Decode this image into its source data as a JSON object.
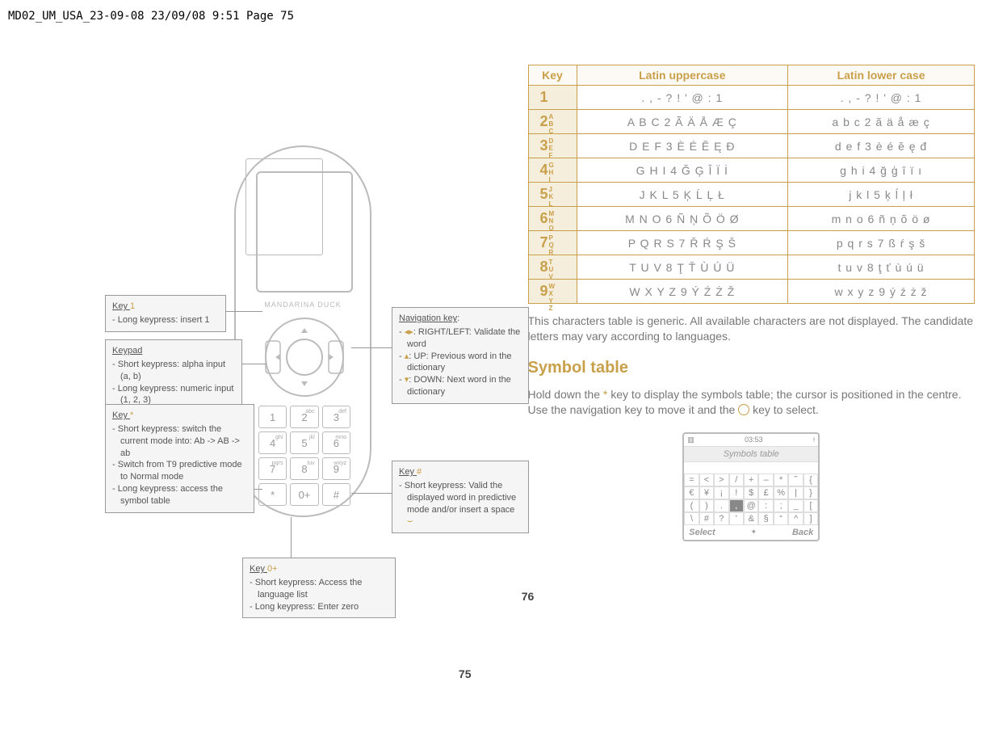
{
  "header": "MD02_UM_USA_23-09-08  23/09/08  9:51  Page 75",
  "left_page_num": "75",
  "right_page_num": "76",
  "phone_brand": "MANDARINA DUCK",
  "callouts": {
    "key1": {
      "title_prefix": "Key ",
      "key_glyph": "1",
      "items": [
        "Long keypress: insert 1"
      ]
    },
    "keypad": {
      "title": "Keypad",
      "items": [
        "Short keypress: alpha input (a, b)",
        "Long keypress: numeric input (1, 2, 3)"
      ]
    },
    "keystar": {
      "title_prefix": "Key ",
      "key_glyph": "*",
      "items": [
        "Short keypress: switch the current mode into: Ab -> AB -> ab",
        "Switch from T9 predictive mode to Normal mode",
        "Long keypress: access the symbol table"
      ]
    },
    "key0": {
      "title_prefix": "Key ",
      "key_glyph": "0+",
      "items": [
        "Short keypress: Access the language list",
        "Long keypress: Enter zero"
      ]
    },
    "nav": {
      "title": "Navigation key",
      "items_raw": [
        {
          "icon": "lr-icon",
          "text": ": RIGHT/LEFT: Validate the word"
        },
        {
          "icon": "up-icon",
          "text": ": UP: Previous word in the dictionary"
        },
        {
          "icon": "down-icon",
          "text": ": DOWN: Next word in the dictionary"
        }
      ],
      "i1": ": RIGHT/LEFT: Validate the word",
      "i2": ": UP: Previous word in the dictionary",
      "i3": ": DOWN: Next word in the dictionary"
    },
    "keyhash": {
      "title_prefix": "Key ",
      "key_glyph": "#",
      "items": [
        "Short keypress: Valid the displayed word in predictive mode and/or insert a space"
      ]
    }
  },
  "keypad_keys": [
    {
      "main": "1",
      "sub": ""
    },
    {
      "main": "2",
      "sub": "abc"
    },
    {
      "main": "3",
      "sub": "def"
    },
    {
      "main": "4",
      "sub": "ghi"
    },
    {
      "main": "5",
      "sub": "jkl"
    },
    {
      "main": "6",
      "sub": "mno"
    },
    {
      "main": "7",
      "sub": "pqrs"
    },
    {
      "main": "8",
      "sub": "tuv"
    },
    {
      "main": "9",
      "sub": "wxyz"
    },
    {
      "main": "*",
      "sub": ""
    },
    {
      "main": "0+",
      "sub": ""
    },
    {
      "main": "#",
      "sub": ""
    }
  ],
  "char_table": {
    "headers": {
      "key": "Key",
      "upper": "Latin uppercase",
      "lower": "Latin lower case"
    },
    "rows": [
      {
        "key": "1",
        "sub": "",
        "upper": ". , - ? ! ' @ : 1",
        "lower": ". , - ? ! ' @ : 1"
      },
      {
        "key": "2",
        "sub": "ABC",
        "upper": "A B C 2 Ã Ä Å Æ Ç",
        "lower": "a b c 2 ã ä å æ ç"
      },
      {
        "key": "3",
        "sub": "DEF",
        "upper": "D E F 3 È É Ĕ Ę Đ",
        "lower": "d e f 3 è é ĕ ę đ"
      },
      {
        "key": "4",
        "sub": "GHI",
        "upper": "G H I 4 Ğ Ģ Î Ï İ",
        "lower": "g h i 4 ğ ģ î ï ı"
      },
      {
        "key": "5",
        "sub": "JKL",
        "upper": "J K L 5 Ķ Ĺ Ļ Ł",
        "lower": "j k l 5 ķ ĺ ļ ł"
      },
      {
        "key": "6",
        "sub": "MNO",
        "upper": "M N O 6 Ñ Ņ Õ Ö Ø",
        "lower": "m n o 6 ñ ņ õ ö ø"
      },
      {
        "key": "7",
        "sub": "PQRS",
        "upper": "P Q R S 7 Ř Ŕ Ş Š",
        "lower": "p q r s 7 ß ŕ ş š"
      },
      {
        "key": "8",
        "sub": "TUV",
        "upper": "T U V 8 Ţ Ť Ù Ú Ü",
        "lower": "t u v 8 ţ ť ù ú ü"
      },
      {
        "key": "9",
        "sub": "WXYZ",
        "upper": "W X Y Z 9 Ý Ź Ż Ž",
        "lower": "w x y z 9 ý ź ż ž"
      }
    ]
  },
  "right_text": {
    "p1": "This characters table is generic. All available characters are not displayed. The candidate letters may vary according to languages.",
    "h1": "Symbol table",
    "p2a": "Hold down the ",
    "p2b": " key to display the symbols table; the cursor is positioned in the centre. Use the navigation key to move it and the ",
    "p2c": " key to select.",
    "star": "*"
  },
  "symbol_screen": {
    "time": "03:53",
    "title": "Symbols table",
    "rows": [
      [
        "=",
        "<",
        ">",
        "/",
        "+",
        "–",
        "*",
        "˜",
        "{"
      ],
      [
        "€",
        "¥",
        "¡",
        "!",
        "$",
        "£",
        "%",
        "|",
        "}"
      ],
      [
        "(",
        ")",
        ".",
        ",",
        "@",
        ":",
        ";",
        "_",
        "["
      ],
      [
        "\\",
        "#",
        "?",
        "'",
        "&",
        "§",
        "“",
        "^",
        "]"
      ]
    ],
    "highlight": [
      2,
      3
    ],
    "soft_left": "Select",
    "soft_right": "Back"
  }
}
